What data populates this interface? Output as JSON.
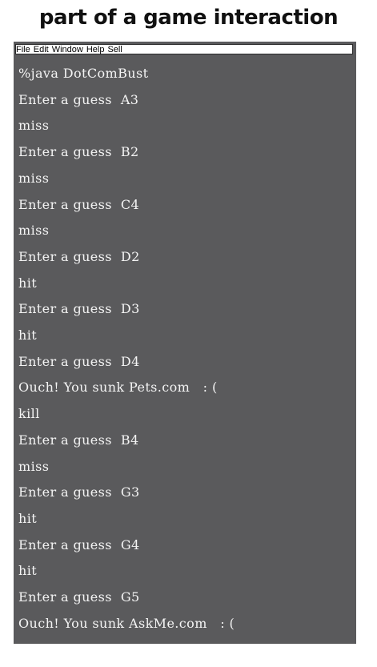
{
  "page_title": "part of a game interaction",
  "menu": [
    "File",
    "Edit",
    "Window",
    "Help",
    "Sell"
  ],
  "console": {
    "lines": [
      "%java DotComBust",
      "Enter a guess  A3",
      "miss",
      "Enter a guess  B2",
      "miss",
      "Enter a guess  C4",
      "miss",
      "Enter a guess  D2",
      "hit",
      "Enter a guess  D3",
      "hit",
      "Enter a guess  D4",
      "Ouch! You sunk Pets.com   : (",
      "kill",
      "Enter a guess  B4",
      "miss",
      "Enter a guess  G3",
      "hit",
      "Enter a guess  G4",
      "hit",
      "Enter a guess  G5",
      "Ouch! You sunk AskMe.com   : ("
    ]
  }
}
